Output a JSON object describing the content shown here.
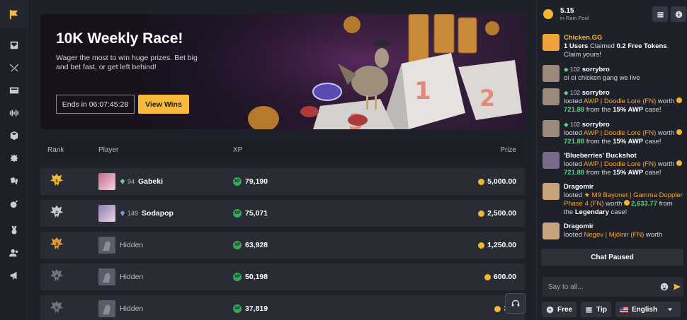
{
  "rail": {
    "icons": [
      "flag-icon",
      "inbox-icon",
      "swords-icon",
      "cases-icon",
      "battle-icon",
      "box-icon",
      "puzzle-icon",
      "cards-icon",
      "bomb-icon",
      "medal-icon",
      "users-icon",
      "megaphone-icon"
    ]
  },
  "banner": {
    "title": "10K Weekly Race!",
    "description": "Wager the most to win huge prizes. Bet big and bet fast, or get left behind!",
    "ends_label": "Ends in 06:07:45:28",
    "view_wins_label": "View Wins",
    "podium": [
      "1",
      "2",
      "3"
    ]
  },
  "leaderboard": {
    "headers": {
      "rank": "Rank",
      "player": "Player",
      "xp": "XP",
      "prize": "Prize"
    },
    "xp_badge": "XP",
    "rows": [
      {
        "rank": "1",
        "level": "94",
        "player": "Gabeki",
        "xp": "79,190",
        "prize": "5,000.00",
        "badge_color": "#f2b632"
      },
      {
        "rank": "2",
        "level": "149",
        "player": "Sodapop",
        "xp": "75,071",
        "prize": "2,500.00",
        "badge_color": "#c9cbd6"
      },
      {
        "rank": "3",
        "level": "",
        "player": "Hidden",
        "xp": "63,928",
        "prize": "1,250.00",
        "badge_color": "#e0953a"
      },
      {
        "rank": "4",
        "level": "",
        "player": "Hidden",
        "xp": "50,198",
        "prize": "600.00",
        "badge_color": "#6f7280"
      },
      {
        "rank": "5",
        "level": "",
        "player": "Hidden",
        "xp": "37,819",
        "prize": "300",
        "badge_color": "#6f7280"
      }
    ]
  },
  "chat": {
    "rain_pool_value": "5.15",
    "rain_pool_label": "in Rain Pool",
    "messages": [
      {
        "name": "Chicken.GG",
        "text_a": "1 Users",
        "text_b": " Claimed ",
        "text_c": "0.2 Free Tokens",
        "text_d": ". Claim yours!"
      },
      {
        "level": "102",
        "name": "sorrybro",
        "text": "oi oi chicken gang we live"
      },
      {
        "level": "102",
        "name": "sorrybro",
        "looted": "looted ",
        "item": "AWP | Doodle Lore (FN)",
        "worth": " worth ",
        "amount": "721.88",
        "from": " from the ",
        "case": "15% AWP",
        "suffix": " case!"
      },
      {
        "level": "102",
        "name": "sorrybro",
        "looted": "looted ",
        "item": "AWP | Doodle Lore (FN)",
        "worth": " worth ",
        "amount": "721.88",
        "from": " from the ",
        "case": "15% AWP",
        "suffix": " case!"
      },
      {
        "name": "'Blueberries' Buckshot",
        "looted": "looted ",
        "item": "AWP | Doodle Lore (FN)",
        "worth": " worth ",
        "amount": "721.88",
        "from": " from the ",
        "case": "15% AWP",
        "suffix": " case!"
      },
      {
        "name": "Dragomir",
        "looted": "looted ",
        "item": "★ M9 Bayonet | Gamma Doppler Phase 4 (FN)",
        "worth": " worth ",
        "amount": "2,633.77",
        "from": " from the ",
        "case": "Legendary",
        "suffix": " case!"
      },
      {
        "name": "Dragomir",
        "looted": "looted ",
        "item": "Negev | Mjölnir (FN)",
        "worth": " worth",
        "amount": "",
        "from": "",
        "case": "",
        "suffix": ""
      }
    ],
    "paused_label": "Chat Paused",
    "input_placeholder": "Say to all...",
    "buttons": {
      "free": "Free",
      "tip": "Tip",
      "language": "English"
    }
  },
  "colors": {
    "accent": "#f6b93b",
    "xp_green": "#3aa85a",
    "loot_orange": "#f2a63a",
    "amount_green": "#5fd17a"
  }
}
